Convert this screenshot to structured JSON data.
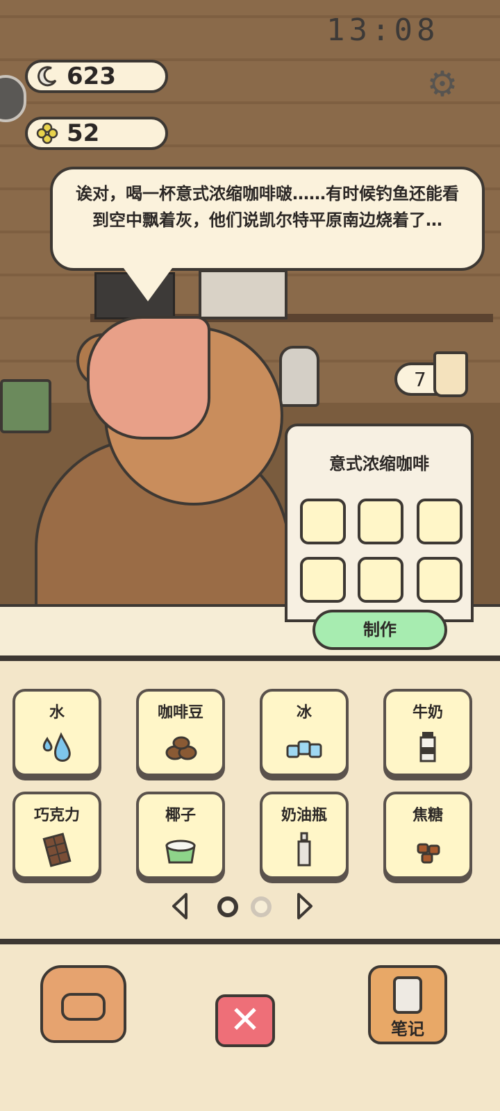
{
  "status": {
    "time": "13:08"
  },
  "currencies": [
    {
      "icon": "moon-icon",
      "value": "623"
    },
    {
      "icon": "clover-icon",
      "value": "52"
    }
  ],
  "dialog": {
    "text": "诶对，喝一杯意式浓缩咖啡啵……有时候钓鱼还能看到空中飘着灰，他们说凯尔特平原南边烧着了…"
  },
  "order": {
    "count": "7"
  },
  "recipe": {
    "title": "意式浓缩咖啡",
    "make_label": "制作"
  },
  "ingredients": [
    {
      "label": "水",
      "icon": "water-drop-icon"
    },
    {
      "label": "咖啡豆",
      "icon": "coffee-bean-icon"
    },
    {
      "label": "冰",
      "icon": "ice-icon"
    },
    {
      "label": "牛奶",
      "icon": "milk-bottle-icon"
    },
    {
      "label": "巧克力",
      "icon": "chocolate-icon"
    },
    {
      "label": "椰子",
      "icon": "coconut-icon"
    },
    {
      "label": "奶油瓶",
      "icon": "cream-bottle-icon"
    },
    {
      "label": "焦糖",
      "icon": "caramel-icon"
    }
  ],
  "pager": {
    "current": 1,
    "total": 2
  },
  "bottom": {
    "notes_label": "笔记"
  }
}
